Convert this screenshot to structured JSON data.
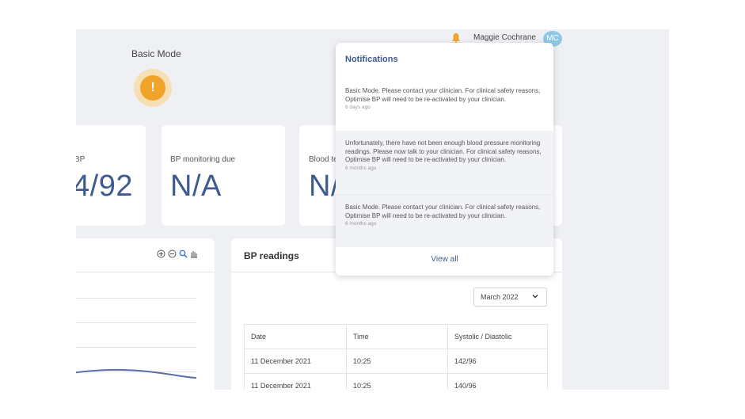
{
  "header": {
    "user_name": "Maggie Cochrane",
    "avatar_initials": "MC"
  },
  "mode": {
    "title": "Basic Mode",
    "alert_symbol": "!"
  },
  "cards": [
    {
      "label": "BP",
      "value": "4/92"
    },
    {
      "label": "BP monitoring due",
      "value": "N/A"
    },
    {
      "label": "Blood te",
      "value": "N/"
    }
  ],
  "chart_panel": {
    "tools": [
      "zoom-in-icon",
      "zoom-out-icon",
      "magnifier-icon",
      "pan-hand-icon"
    ]
  },
  "readings_panel": {
    "title": "BP readings",
    "month_select": "March 2022",
    "columns": [
      "Date",
      "Time",
      "Systolic / Diastolic"
    ],
    "rows": [
      [
        "11 December 2021",
        "10:25",
        "142/96"
      ],
      [
        "11 December 2021",
        "10:25",
        "140/96"
      ]
    ]
  },
  "notifications": {
    "title": "Notifications",
    "items": [
      {
        "text": "Basic Mode. Please contact your clinician. For clinical safety reasons, Optimise BP will need to be re-activated by your clinician.",
        "time": "6 days ago"
      },
      {
        "text": "Unfortunately, there have not been enough blood pressure monitoring readings. Please now talk to your clinician. For clinical safety reasons, Optimise BP will need to be re-activated by your clinician.",
        "time": "6 months ago"
      },
      {
        "text": "Basic Mode. Please contact your clinician. For clinical safety reasons, Optimise BP will need to be re-activated by your clinician.",
        "time": "6 months ago"
      }
    ],
    "view_all": "View all"
  },
  "colors": {
    "accent": "#3e5a8f",
    "alert": "#f2a32a",
    "avatar": "#8fc7e6",
    "background": "#eef0f4"
  }
}
